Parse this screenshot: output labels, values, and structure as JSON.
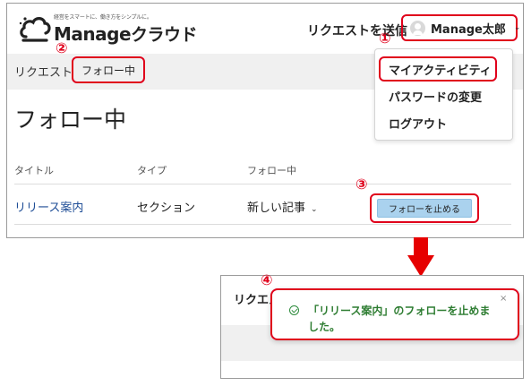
{
  "header": {
    "logo": {
      "tagline": "経営をスマートに、働き方をシンプルに。",
      "name_latin": "Manage",
      "name_kana": "クラウド"
    },
    "request_link": "リクエストを送信",
    "user_name": "Manage太郎"
  },
  "user_dropdown": {
    "items": [
      {
        "label": "マイアクティビティ"
      },
      {
        "label": "パスワードの変更"
      },
      {
        "label": "ログアウト"
      }
    ]
  },
  "breadcrumb": {
    "items": [
      {
        "label": "リクエスト"
      },
      {
        "label": "フォロー中"
      }
    ]
  },
  "page_title": "フォロー中",
  "table": {
    "headers": [
      "タイトル",
      "タイプ",
      "フォロー中"
    ],
    "rows": [
      {
        "title": "リリース案内",
        "type": "セクション",
        "follow_setting": "新しい記事",
        "action_label": "フォローを止める"
      }
    ]
  },
  "step_markers": [
    "①",
    "②",
    "③",
    "④"
  ],
  "after_panel": {
    "header_partial": "リクエス",
    "toast_message": "「リリース案内」のフォローを止めました。",
    "toast_close": "×"
  },
  "colors": {
    "highlight_border": "#e0001b",
    "arrow": "#e60000",
    "button_bg": "#aad2ee",
    "link": "#1e4d96",
    "success": "#2e7d32"
  }
}
